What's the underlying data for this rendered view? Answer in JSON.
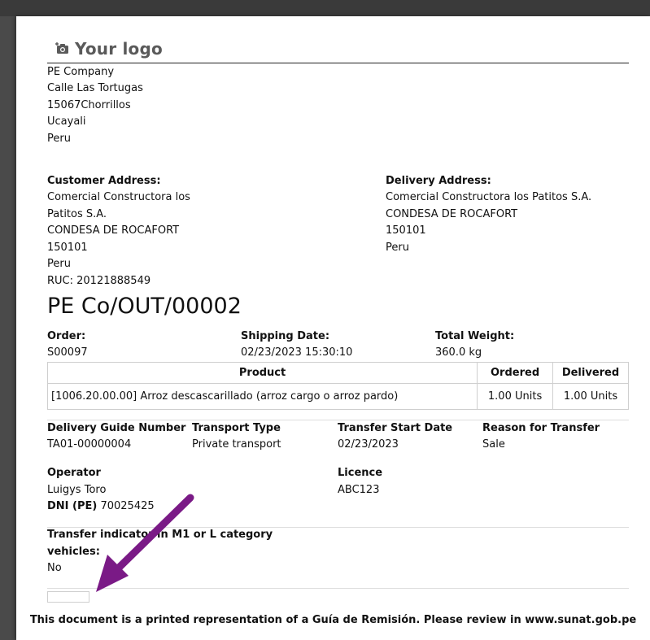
{
  "logo": {
    "text": "Your logo"
  },
  "company": [
    "PE Company",
    "Calle Las Tortugas",
    "15067Chorrillos",
    "Ucayali",
    "Peru"
  ],
  "customer": {
    "heading": "Customer Address:",
    "lines": [
      "Comercial Constructora los",
      "Patitos S.A.",
      "CONDESA DE ROCAFORT",
      "150101",
      "Peru",
      "RUC: 20121888549"
    ]
  },
  "delivery": {
    "heading": "Delivery Address:",
    "lines": [
      "Comercial Constructora los Patitos S.A.",
      "CONDESA DE ROCAFORT",
      "150101",
      "Peru"
    ]
  },
  "document_title": "PE Co/OUT/00002",
  "order": {
    "order_label": "Order:",
    "order_value": "S00097",
    "ship_label": "Shipping Date:",
    "ship_value": "02/23/2023 15:30:10",
    "weight_label": "Total Weight:",
    "weight_value": "360.0 kg"
  },
  "table": {
    "headers": [
      "Product",
      "Ordered",
      "Delivered"
    ],
    "rows": [
      [
        "[1006.20.00.00] Arroz descascarillado (arroz cargo o arroz pardo)",
        "1.00 Units",
        "1.00 Units"
      ]
    ]
  },
  "guide": {
    "number_label": "Delivery Guide Number",
    "number_value": "TA01-00000004",
    "transport_label": "Transport Type",
    "transport_value": "Private transport",
    "start_label": "Transfer Start Date",
    "start_value": "02/23/2023",
    "reason_label": "Reason for Transfer",
    "reason_value": "Sale"
  },
  "operator": {
    "label": "Operator",
    "name": "Luigys Toro",
    "dni_label": "DNI (PE)",
    "dni_value": "70025425",
    "licence_label": "Licence",
    "licence_value": "ABC123"
  },
  "indicator": {
    "label_line1": "Transfer indicator in M1 or L category",
    "label_line2": "vehicles:",
    "value": "No"
  },
  "footer": "This document is a printed representation of a Guía de Remisión. Please review in www.sunat.gob.pe",
  "colors": {
    "arrow": "#7a1a86",
    "logo": "#5a5a5a"
  },
  "icons": {
    "logo": "camera-plus-icon",
    "annotation": "arrow-icon"
  }
}
